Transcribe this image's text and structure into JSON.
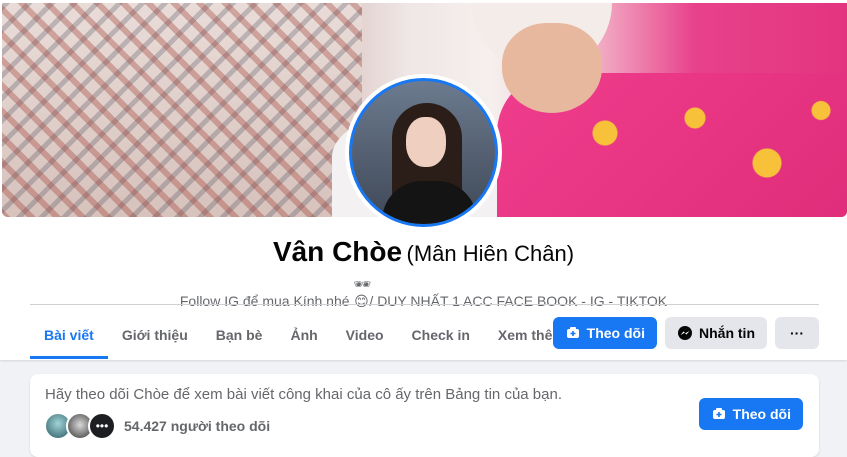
{
  "profile": {
    "name": "Vân Chòe",
    "alternate_name": "(Mân Hiên Chân)",
    "bio_text": "Follow IG để mua Kính nhé",
    "bio_emoji": "🕶😊",
    "bio_extra": "/ DUY NHẤT 1 ACC FACE BOOK - IG - TIKTOK"
  },
  "tabs": [
    {
      "label": "Bài viết",
      "active": true
    },
    {
      "label": "Giới thiệu",
      "active": false
    },
    {
      "label": "Bạn bè",
      "active": false
    },
    {
      "label": "Ảnh",
      "active": false
    },
    {
      "label": "Video",
      "active": false
    },
    {
      "label": "Check in",
      "active": false
    },
    {
      "label": "Xem thêm",
      "active": false
    }
  ],
  "actions": {
    "follow_label": "Theo dõi",
    "follow_icon": "follow-icon",
    "message_label": "Nhắn tin",
    "message_icon": "messenger-icon",
    "more_icon": "more-icon",
    "more_glyph": "···"
  },
  "follow_prompt": {
    "text": "Hãy theo dõi Chòe để xem bài viết công khai của cô ấy trên Bảng tin của bạn.",
    "followers_more_glyph": "•••",
    "followers_count": "54.427 người theo dõi",
    "button_label": "Theo dõi"
  },
  "colors": {
    "accent": "#1877f2",
    "background": "#f0f2f5",
    "secondary_button": "#e4e6eb",
    "muted_text": "#65676b"
  }
}
